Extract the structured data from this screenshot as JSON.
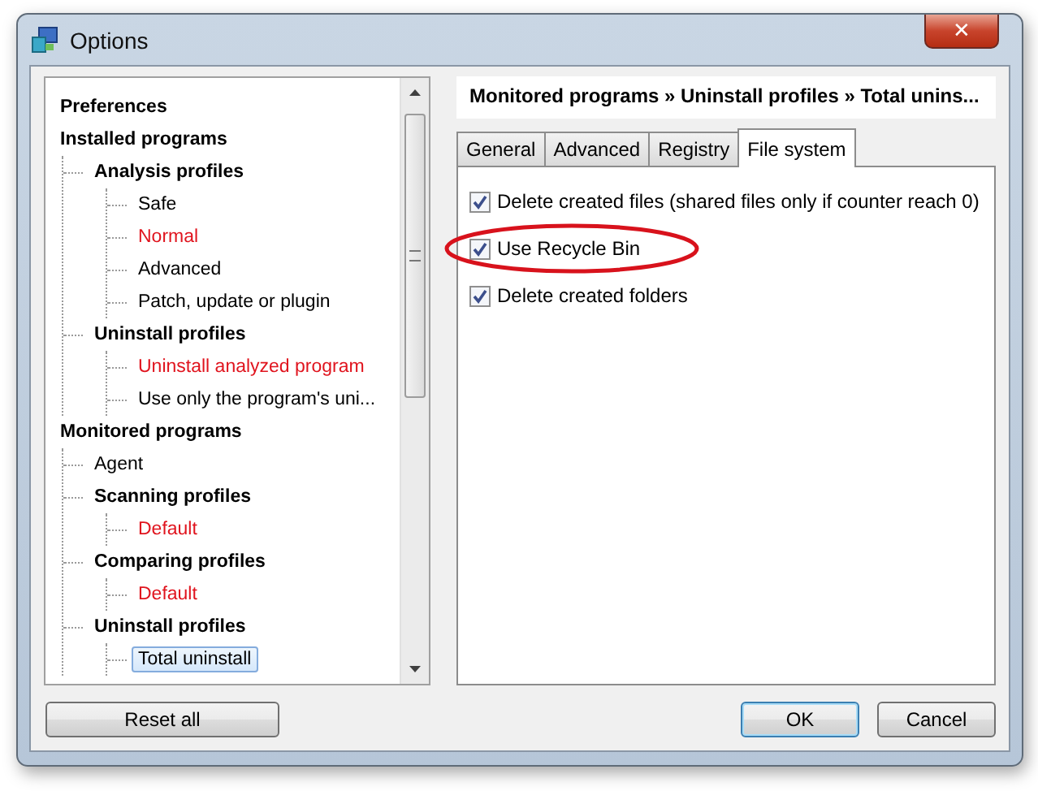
{
  "window": {
    "title": "Options",
    "close_label": "✕"
  },
  "tree": {
    "items": [
      {
        "label": "Preferences",
        "color": "#000000",
        "selected": false
      },
      {
        "label": "Installed programs",
        "color": "#000000",
        "selected": false,
        "children": [
          {
            "label": "Analysis profiles",
            "color": "#000000",
            "selected": false,
            "children": [
              {
                "label": "Safe",
                "color": "#000000",
                "selected": false
              },
              {
                "label": "Normal",
                "color": "#e0141e",
                "selected": false
              },
              {
                "label": "Advanced",
                "color": "#000000",
                "selected": false
              },
              {
                "label": "Patch, update or plugin",
                "color": "#000000",
                "selected": false
              }
            ]
          },
          {
            "label": "Uninstall profiles",
            "color": "#000000",
            "selected": false,
            "children": [
              {
                "label": "Uninstall analyzed program",
                "color": "#e0141e",
                "selected": false
              },
              {
                "label": "Use only the program's uni...",
                "color": "#000000",
                "selected": false
              }
            ]
          }
        ]
      },
      {
        "label": "Monitored programs",
        "color": "#000000",
        "selected": false,
        "children": [
          {
            "label": "Agent",
            "color": "#000000",
            "selected": false
          },
          {
            "label": "Scanning profiles",
            "color": "#000000",
            "selected": false,
            "children": [
              {
                "label": "Default",
                "color": "#e0141e",
                "selected": false
              }
            ]
          },
          {
            "label": "Comparing profiles",
            "color": "#000000",
            "selected": false,
            "children": [
              {
                "label": "Default",
                "color": "#e0141e",
                "selected": false
              }
            ]
          },
          {
            "label": "Uninstall profiles",
            "color": "#000000",
            "selected": false,
            "children": [
              {
                "label": "Total uninstall",
                "color": "#000000",
                "selected": true
              }
            ]
          }
        ]
      }
    ]
  },
  "breadcrumb": "Monitored programs » Uninstall profiles » Total unins...",
  "tabs": [
    {
      "label": "General",
      "selected": false
    },
    {
      "label": "Advanced",
      "selected": false
    },
    {
      "label": "Registry",
      "selected": false
    },
    {
      "label": "File system",
      "selected": true
    }
  ],
  "options": [
    {
      "label": "Delete created files (shared files only if counter reach 0)",
      "checked": true,
      "highlighted": false
    },
    {
      "label": "Use Recycle Bin",
      "checked": true,
      "highlighted": true
    },
    {
      "label": "Delete created folders",
      "checked": true,
      "highlighted": false
    }
  ],
  "buttons": {
    "reset": "Reset all",
    "ok": "OK",
    "cancel": "Cancel"
  }
}
